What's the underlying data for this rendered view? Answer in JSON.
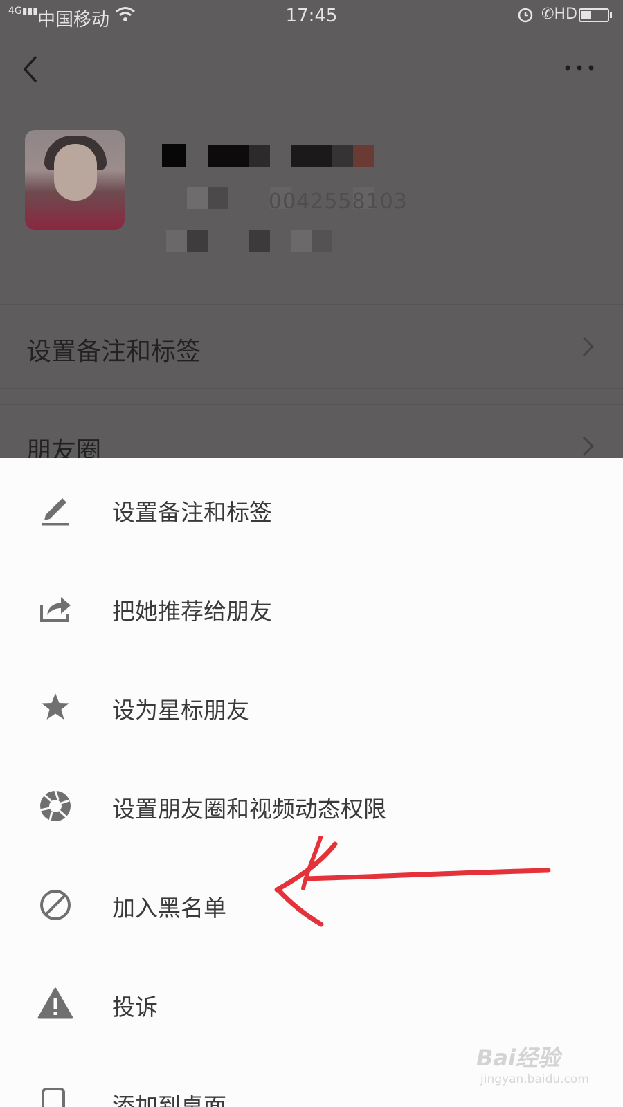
{
  "status_bar": {
    "signal": "4G",
    "carrier": "中国移动",
    "time": "17:45",
    "hd": "HD"
  },
  "profile": {
    "id_partial": "0042558103"
  },
  "background_rows": [
    {
      "label": "设置备注和标签"
    },
    {
      "label": "朋友圈"
    }
  ],
  "menu": {
    "items": [
      {
        "label": "设置备注和标签",
        "icon": "pencil-icon"
      },
      {
        "label": "把她推荐给朋友",
        "icon": "share-icon"
      },
      {
        "label": "设为星标朋友",
        "icon": "star-icon"
      },
      {
        "label": "设置朋友圈和视频动态权限",
        "icon": "aperture-icon"
      },
      {
        "label": "加入黑名单",
        "icon": "block-icon"
      },
      {
        "label": "投诉",
        "icon": "warning-icon"
      },
      {
        "label": "添加到桌面",
        "icon": "add-to-desktop-icon"
      }
    ]
  },
  "watermark": {
    "brand": "Bai经验",
    "url": "jingyan.baidu.com"
  },
  "colors": {
    "overlay": "#5e5c5d",
    "sheet": "#fcfcfc",
    "icon": "#707070",
    "annotation": "#e4323a"
  }
}
